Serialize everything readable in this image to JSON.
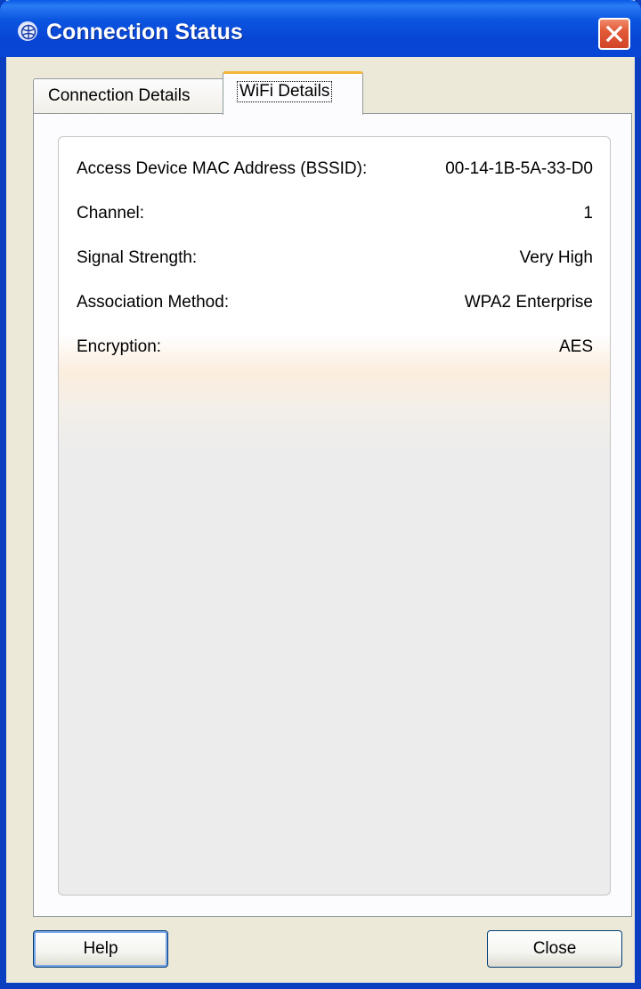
{
  "window": {
    "title": "Connection Status",
    "accent_color": "#0a46d6",
    "icon": "network-globe-icon"
  },
  "tabs": [
    {
      "label": "Connection Details",
      "selected": false
    },
    {
      "label": "WiFi Details",
      "selected": true
    }
  ],
  "wifi_details": {
    "rows": [
      {
        "label": "Access Device MAC Address (BSSID):",
        "value": "00-14-1B-5A-33-D0"
      },
      {
        "label": "Channel:",
        "value": "1"
      },
      {
        "label": "Signal Strength:",
        "value": "Very High"
      },
      {
        "label": "Association Method:",
        "value": "WPA2 Enterprise"
      },
      {
        "label": "Encryption:",
        "value": "AES"
      }
    ]
  },
  "buttons": {
    "help": "Help",
    "close": "Close"
  }
}
